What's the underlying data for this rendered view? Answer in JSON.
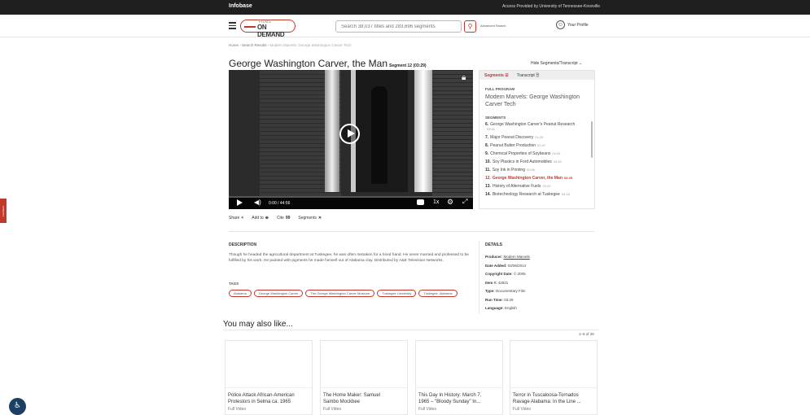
{
  "topbar": {
    "brand": "Infobase",
    "access": "Access Provided by University of Tennessee-Knoxville"
  },
  "header": {
    "logo_top": "FILMS",
    "logo_main": "ON DEMAND",
    "search_placeholder": "Search 38,037 titles and 283,696 segments",
    "advanced": "Advanced Search",
    "profile": "Your Profile"
  },
  "breadcrumb": {
    "home": "Home",
    "sep": " › ",
    "results": "Search Results",
    "current": "Modern Marvels: George Washington Carver Tech"
  },
  "video": {
    "title": "George Washington Carver, the Man",
    "segment": "Segment 12 (03:29)",
    "hide_link": "Hide Segments/Transcript ⌄",
    "time": "0:00 / 44:56",
    "speed": "1x"
  },
  "actions": [
    {
      "label": "Share",
      "icon": "<"
    },
    {
      "label": "Add to",
      "icon": "⊕"
    },
    {
      "label": "Cite",
      "icon": "99"
    },
    {
      "label": "Segments",
      "icon": "✕"
    }
  ],
  "side": {
    "tab_segments": "Segments ☰",
    "tab_transcript": "Transcript 🗎",
    "full_program_label": "FULL PROGRAM",
    "full_program": "Modern Marvels: George Washington Carver Tech",
    "segments_label": "SEGMENTS",
    "segments": [
      {
        "num": "6.",
        "title": "George Washington Carver's Peanut Research",
        "dur": "03:41"
      },
      {
        "num": "7.",
        "title": "Major Peanut Discovery",
        "dur": "01:23"
      },
      {
        "num": "8.",
        "title": "Peanut Butter Production",
        "dur": "02:47"
      },
      {
        "num": "9.",
        "title": "Chemical Properties of Soybeans",
        "dur": "02:09"
      },
      {
        "num": "10.",
        "title": "Soy Plastics in Ford Automobiles",
        "dur": "03:43"
      },
      {
        "num": "11.",
        "title": "Soy Ink in Printing",
        "dur": "02:06"
      },
      {
        "num": "12.",
        "title": "George Washington Carver, the Man",
        "dur": "03:29"
      },
      {
        "num": "13.",
        "title": "History of Alternative Fuels",
        "dur": "03:29"
      },
      {
        "num": "14.",
        "title": "Biotechnology Research at Tuskegee",
        "dur": "03:18"
      }
    ]
  },
  "description": {
    "heading": "DESCRIPTION",
    "text": "Though he headed the agricultural department at Tuskegee, he was often mistaken for a hired hand. He never married and professed to be fulfilled by his work. He painted with pigments he made himself out of Alabama clay. Distributed by A&E Television Networks.",
    "tags_heading": "TAGS",
    "tags": [
      "Alabama",
      "George Washington Carver",
      "The George Washington Carver Museum",
      "Tuskegee University",
      "Tuskegee, Alabama"
    ]
  },
  "details": {
    "heading": "DETAILS",
    "producer_label": "Producer:",
    "producer": "Modern Marvels",
    "date_label": "Date Added:",
    "date": "03/06/2014",
    "copyright_label": "Copyright Date:",
    "copyright": "© 2005",
    "item_label": "Item #:",
    "item": "42831",
    "type_label": "Type:",
    "type": "Documentary Film",
    "runtime_label": "Run Time:",
    "runtime": "03:29",
    "language_label": "Language:",
    "language": "English"
  },
  "related": {
    "heading": "You may also like...",
    "count": "1–6 of 26",
    "cards": [
      {
        "line1": "Police Attack African-American",
        "line2": "Protestors in Selma ca. 1965",
        "type": "Full Video"
      },
      {
        "line1": "The Home Maker: Samuel",
        "line2": "Sambo Mockbee",
        "type": "Full Video"
      },
      {
        "line1": "This Day In History: March 7,",
        "line2": "1965 – \"Bloody Sunday\" In...",
        "type": "Full Video"
      },
      {
        "line1": "Terror in Tuscaloosa-Tornados",
        "line2": "Ravage Alabama: In the Line ...",
        "type": "Full Video"
      }
    ]
  },
  "feedback": "Feedback"
}
